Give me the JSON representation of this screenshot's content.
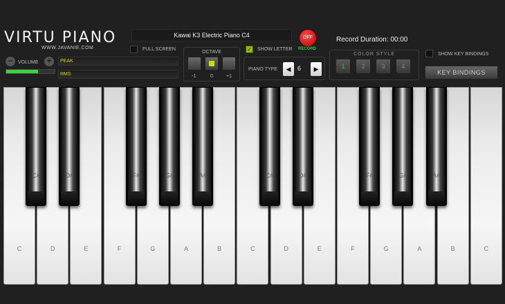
{
  "logo": {
    "title": "VIRTU PIANO",
    "subtitle": "WWW.JAVANIE.COM"
  },
  "volume": {
    "label": "VOLUME",
    "minus": "−",
    "plus": "+",
    "level_percent": 65
  },
  "meters": {
    "peak_label": "PEAK",
    "rms_label": "RMS"
  },
  "instrument": {
    "name": "Kawai K3 Electric Piano C4"
  },
  "fullscreen": {
    "label": "FULL SCREEN",
    "checked": false
  },
  "octave": {
    "label": "OCTAVE",
    "values": [
      "-1",
      "0",
      "+1"
    ],
    "selected": "0"
  },
  "record": {
    "button": "OFF",
    "label": "RECORD",
    "duration": "Record Duration: 00:00"
  },
  "show_letter": {
    "label": "SHOW LETTER",
    "checked": true,
    "check_mark": "✓"
  },
  "piano_type": {
    "label": "PIANO TYPE",
    "value": "6",
    "prev": "◀",
    "next": "▶"
  },
  "color_style": {
    "label": "COLOR STYLE",
    "options": [
      "1",
      "2",
      "3",
      "4"
    ],
    "selected": "1"
  },
  "key_bindings": {
    "show_label": "SHOW KEY BINDINGS",
    "button": "KEY BINDINGS"
  },
  "keyboard": {
    "white_keys": [
      "C",
      "D",
      "E",
      "F",
      "G",
      "A",
      "B",
      "C",
      "D",
      "E",
      "F",
      "G",
      "A",
      "B",
      "C"
    ],
    "black_keys": [
      "C#",
      "D#",
      "F#",
      "G#",
      "A#",
      "C#",
      "D#",
      "F#",
      "G#",
      "A#"
    ]
  },
  "colors": {
    "accent_green": "#3fd13f",
    "record_red": "#cc0000",
    "meter_text": "#e6d300"
  }
}
